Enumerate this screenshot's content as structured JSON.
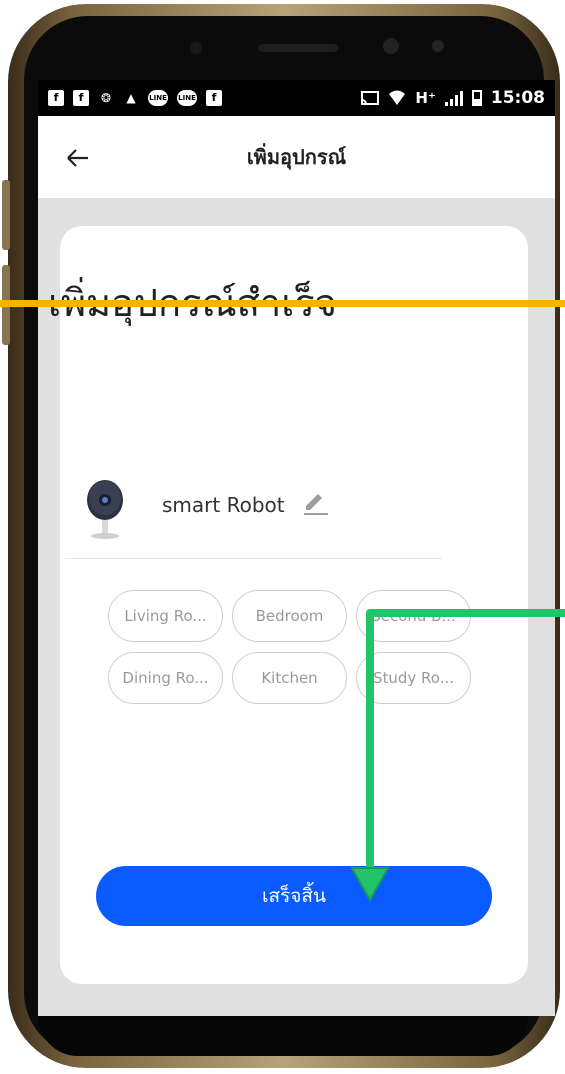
{
  "status_bar": {
    "left_icons": [
      "facebook-icon",
      "facebook-icon",
      "browser-icon",
      "bell-icon",
      "line-icon",
      "line-icon",
      "facebook-icon"
    ],
    "right_icons": [
      "cast-icon",
      "wifi-icon",
      "network-type",
      "signal-icon",
      "battery-icon"
    ],
    "network_type": "H⁺",
    "time": "15:08"
  },
  "app_bar": {
    "back_icon": "arrow-left-icon",
    "title": "เพิ่มอุปกรณ์"
  },
  "main": {
    "success_title": "เพิ่มอุปกรณ์สำเร็จ",
    "device": {
      "icon": "camera-icon",
      "name": "smart Robot",
      "edit_icon": "pencil-icon"
    },
    "rooms": [
      "Living Ro...",
      "Bedroom",
      "Second B...",
      "Dining Ro...",
      "Kitchen",
      "Study Ro..."
    ],
    "done_button": "เสร็จสิ้น"
  },
  "colors": {
    "primary_button": "#0a5bff",
    "annotation_orange": "#ffb000",
    "annotation_green": "#22c46a"
  }
}
